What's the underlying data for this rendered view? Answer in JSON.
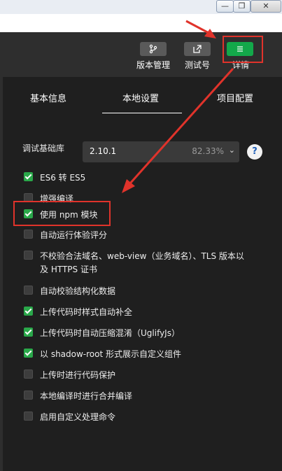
{
  "window": {
    "minimize": "—",
    "maximize": "❐",
    "close": "✕"
  },
  "toolbar": {
    "version_label": "版本管理",
    "test_label": "测试号",
    "detail_label": "详情"
  },
  "tabs": [
    "基本信息",
    "本地设置",
    "项目配置"
  ],
  "debug_lib": {
    "label": "调试基础库",
    "version": "2.10.1",
    "percent": "82.33%",
    "help": "?"
  },
  "options": [
    {
      "label": "ES6 转 ES5",
      "checked": true
    },
    {
      "label": "增强编译",
      "checked": false
    },
    {
      "label": "使用 npm 模块",
      "checked": true
    },
    {
      "label": "自动运行体验评分",
      "checked": false
    },
    {
      "label": "不校验合法域名、web-view（业务域名）、TLS 版本以及 HTTPS 证书",
      "checked": false
    },
    {
      "label": "自动校验结构化数据",
      "checked": false
    },
    {
      "label": "上传代码时样式自动补全",
      "checked": true
    },
    {
      "label": "上传代码时自动压缩混淆（UglifyJs）",
      "checked": true
    },
    {
      "label": "以 shadow-root 形式展示自定义组件",
      "checked": true
    },
    {
      "label": "上传时进行代码保护",
      "checked": false
    },
    {
      "label": "本地编译时进行合并编译",
      "checked": false
    },
    {
      "label": "启用自定义处理命令",
      "checked": false
    }
  ],
  "colors": {
    "accent_green": "#13a84a",
    "highlight_red": "#e0332b"
  }
}
